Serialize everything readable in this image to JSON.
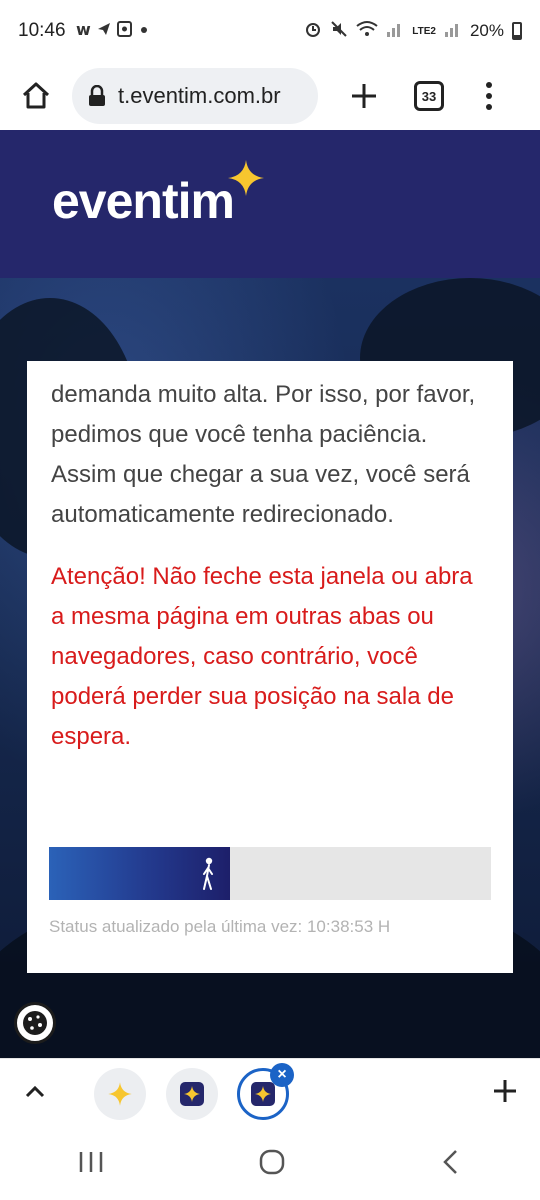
{
  "status_bar": {
    "time": "10:46",
    "battery": "20%",
    "network_label": "LTE2"
  },
  "browser": {
    "url": "t.eventim.com.br",
    "tab_count": "33"
  },
  "header": {
    "logo_text": "eventim",
    "brand_color": "#25276b"
  },
  "card": {
    "body_text": "demanda muito alta. Por isso, por favor, pedimos que você tenha paciência. Assim que chegar a sua vez, você será automaticamente redirecionado.",
    "warning_text": "Atenção! Não feche esta janela ou abra a mesma página em outras abas ou navegadores, caso contrário, você poderá perder sua posição na sala de espera.",
    "warning_color": "#d81b1b",
    "progress_fraction": 0.41,
    "status_text": "Status atualizado pela última vez: 10:38:53 H"
  },
  "icons": {
    "cookie": "cookie-icon",
    "star": "sparkle-star-icon",
    "walker": "walking-person-icon"
  }
}
